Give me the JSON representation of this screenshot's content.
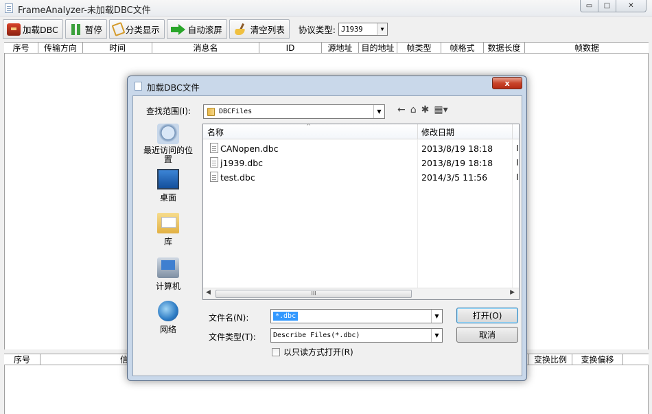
{
  "window": {
    "title": "FrameAnalyzer-未加载DBC文件"
  },
  "toolbar": {
    "load_dbc": "加载DBC",
    "pause": "暂停",
    "category": "分类显示",
    "auto_scroll": "自动滚屏",
    "clear_list": "清空列表",
    "protocol_label": "协议类型:",
    "protocol_value": "J1939"
  },
  "frame_columns": [
    "序号",
    "传输方向",
    "时间",
    "消息名",
    "ID",
    "源地址",
    "目的地址",
    "帧类型",
    "帧格式",
    "数据长度",
    "帧数据"
  ],
  "signal_columns": [
    "序号",
    "信号名",
    "变换比例",
    "变换偏移"
  ],
  "dialog": {
    "title": "加载DBC文件",
    "close": "x",
    "look_in_label": "查找范围(I):",
    "look_in_value": "DBCFiles",
    "places": [
      "最近访问的位置",
      "桌面",
      "库",
      "计算机",
      "网络"
    ],
    "list_headers": {
      "name": "名称",
      "modified": "修改日期"
    },
    "files": [
      {
        "name": "CANopen.dbc",
        "date": "2013/8/19 18:18",
        "cut": "I"
      },
      {
        "name": "j1939.dbc",
        "date": "2013/8/19 18:18",
        "cut": "I"
      },
      {
        "name": "test.dbc",
        "date": "2014/3/5 11:56",
        "cut": "I"
      }
    ],
    "scroll_thumb": "III",
    "file_name_label": "文件名(N):",
    "file_name_value": "*.dbc",
    "file_type_label": "文件类型(T):",
    "file_type_value": "Describe Files(*.dbc)",
    "readonly_label": "以只读方式打开(R)",
    "open_button": "打开(O)",
    "cancel_button": "取消"
  }
}
